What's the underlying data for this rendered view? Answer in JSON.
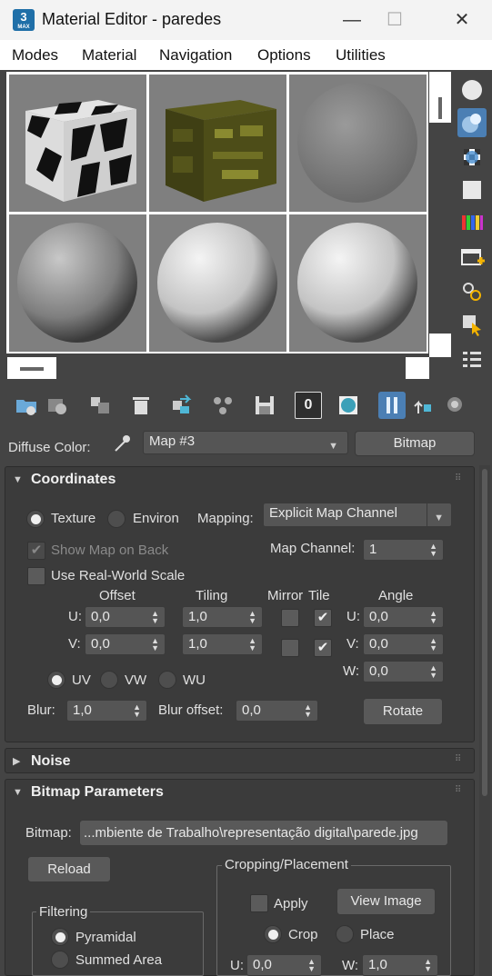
{
  "window": {
    "title": "Material Editor - paredes",
    "app_badge": "3",
    "app_badge_sub": "MAX",
    "minimize": "—",
    "maximize": "☐",
    "close": "✕"
  },
  "menu": [
    "Modes",
    "Material",
    "Navigation",
    "Options",
    "Utilities"
  ],
  "sample_slots": [
    {
      "name": "checker-cube",
      "selected": false
    },
    {
      "name": "textured-cube",
      "selected": false
    },
    {
      "name": "gray-sphere",
      "selected": false
    },
    {
      "name": "concrete-sphere",
      "selected": true
    },
    {
      "name": "white-sphere",
      "selected": false
    },
    {
      "name": "white-sphere-2",
      "selected": false
    }
  ],
  "icons": {
    "sidebar": [
      "sample-type-icon",
      "backlight-icon",
      "background-icon",
      "sample-uv-tiling-icon",
      "video-color-check-icon",
      "make-preview-icon",
      "material-options-icon",
      "select-by-material-icon",
      "material-map-navigator-icon"
    ],
    "toolbar": [
      "get-material-icon",
      "put-material-icon",
      "assign-to-selection-icon",
      "delete-icon",
      "make-unique-icon",
      "put-to-library-icon",
      "save-icon",
      "material-id-channel-icon",
      "show-shaded-icon",
      "show-end-result-icon",
      "go-to-parent-icon",
      "go-forward-icon"
    ]
  },
  "toolbar": {
    "material_id": "0"
  },
  "diffuse": {
    "label": "Diffuse Color:",
    "map_name": "Map #3",
    "type_button": "Bitmap"
  },
  "coordinates": {
    "header": "Coordinates",
    "texture": "Texture",
    "environ": "Environ",
    "mapping_label": "Mapping:",
    "mapping_value": "Explicit Map Channel",
    "show_map_on_back": "Show Map on Back",
    "map_channel_label": "Map Channel:",
    "map_channel_value": "1",
    "use_real_world": "Use Real-World Scale",
    "col_offset": "Offset",
    "col_tiling": "Tiling",
    "col_mirror": "Mirror",
    "col_tile": "Tile",
    "col_angle": "Angle",
    "u_label": "U:",
    "v_label": "V:",
    "w_label": "W:",
    "offset_u": "0,0",
    "offset_v": "0,0",
    "tiling_u": "1,0",
    "tiling_v": "1,0",
    "tile_check": "✔",
    "angle_u": "0,0",
    "angle_v": "0,0",
    "angle_w": "0,0",
    "uv": "UV",
    "vw": "VW",
    "wu": "WU",
    "blur_label": "Blur:",
    "blur_value": "1,0",
    "blur_offset_label": "Blur offset:",
    "blur_offset_value": "0,0",
    "rotate": "Rotate"
  },
  "noise": {
    "header": "Noise"
  },
  "bitmap": {
    "header": "Bitmap Parameters",
    "bitmap_label": "Bitmap:",
    "path": "...mbiente de Trabalho\\representação digital\\parede.jpg",
    "reload": "Reload",
    "cropping_title": "Cropping/Placement",
    "apply": "Apply",
    "view_image": "View Image",
    "crop": "Crop",
    "place": "Place",
    "u_label": "U:",
    "u_value": "0,0",
    "w_label": "W:",
    "w_value": "1,0",
    "filtering_title": "Filtering",
    "pyramidal": "Pyramidal",
    "summed_area": "Summed Area"
  }
}
